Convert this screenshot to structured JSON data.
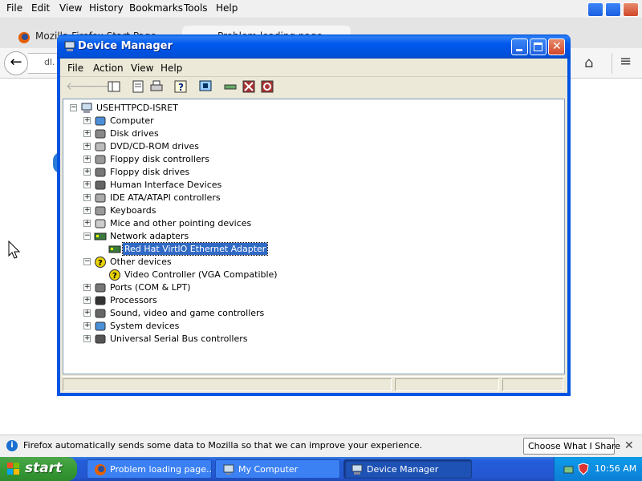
{
  "firefox": {
    "menu": [
      "File",
      "Edit",
      "View",
      "History",
      "Bookmarks",
      "Tools",
      "Help"
    ],
    "tabs": [
      {
        "label": "Mozilla Firefox Start Page"
      },
      {
        "label": "Problem loading page"
      }
    ],
    "url_fragment": "dl.",
    "notification": "Firefox automatically sends some data to Mozilla so that we can improve your experience.",
    "notification_button": "Choose What I Share"
  },
  "device_manager": {
    "title": "Device Manager",
    "menu": [
      "File",
      "Action",
      "View",
      "Help"
    ],
    "toolbar_icons": [
      "back-icon",
      "forward-icon",
      "show-hide-console-tree-icon",
      "properties-icon",
      "print-icon",
      "help-icon",
      "scan-hardware-icon",
      "update-driver-icon",
      "uninstall-icon",
      "disable-icon"
    ],
    "root": "USEHTTPCD-ISRET",
    "tree": [
      {
        "label": "Computer",
        "icon": "computer-icon",
        "expanded": false,
        "level": 1
      },
      {
        "label": "Disk drives",
        "icon": "disk-drive-icon",
        "expanded": false,
        "level": 1
      },
      {
        "label": "DVD/CD-ROM drives",
        "icon": "cdrom-icon",
        "expanded": false,
        "level": 1
      },
      {
        "label": "Floppy disk controllers",
        "icon": "floppy-controller-icon",
        "expanded": false,
        "level": 1
      },
      {
        "label": "Floppy disk drives",
        "icon": "floppy-drive-icon",
        "expanded": false,
        "level": 1
      },
      {
        "label": "Human Interface Devices",
        "icon": "hid-icon",
        "expanded": false,
        "level": 1
      },
      {
        "label": "IDE ATA/ATAPI controllers",
        "icon": "ide-controller-icon",
        "expanded": false,
        "level": 1
      },
      {
        "label": "Keyboards",
        "icon": "keyboard-icon",
        "expanded": false,
        "level": 1
      },
      {
        "label": "Mice and other pointing devices",
        "icon": "mouse-icon",
        "expanded": false,
        "level": 1
      },
      {
        "label": "Network adapters",
        "icon": "network-adapter-icon",
        "expanded": true,
        "level": 1
      },
      {
        "label": "Red Hat VirtIO Ethernet Adapter",
        "icon": "network-card-icon",
        "level": 2,
        "selected": true
      },
      {
        "label": "Other devices",
        "icon": "unknown-device-icon",
        "expanded": true,
        "level": 1
      },
      {
        "label": "Video Controller (VGA Compatible)",
        "icon": "unknown-device-icon",
        "level": 2
      },
      {
        "label": "Ports (COM & LPT)",
        "icon": "port-icon",
        "expanded": false,
        "level": 1
      },
      {
        "label": "Processors",
        "icon": "processor-icon",
        "expanded": false,
        "level": 1
      },
      {
        "label": "Sound, video and game controllers",
        "icon": "sound-icon",
        "expanded": false,
        "level": 1
      },
      {
        "label": "System devices",
        "icon": "system-device-icon",
        "expanded": false,
        "level": 1
      },
      {
        "label": "Universal Serial Bus controllers",
        "icon": "usb-icon",
        "expanded": false,
        "level": 1
      }
    ]
  },
  "taskbar": {
    "start": "start",
    "items": [
      {
        "label": "Problem loading page...",
        "icon": "firefox-icon",
        "active": false
      },
      {
        "label": "My Computer",
        "icon": "my-computer-icon",
        "active": false
      },
      {
        "label": "Device Manager",
        "icon": "device-manager-icon",
        "active": true
      }
    ],
    "clock": "10:56 AM"
  }
}
